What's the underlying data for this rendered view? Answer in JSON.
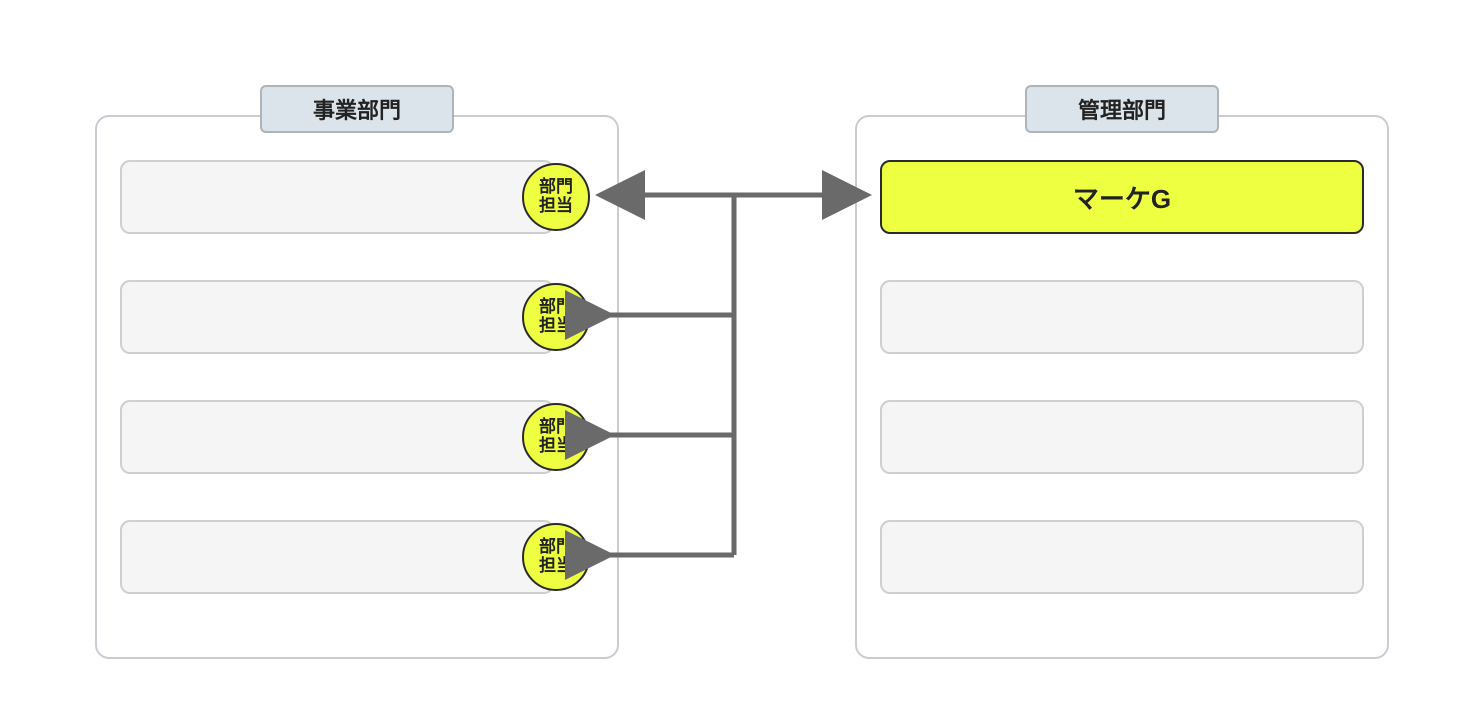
{
  "left_group": {
    "label": "事業部門",
    "staff_label_line1": "部門",
    "staff_label_line2": "担当",
    "rows": 4
  },
  "right_group": {
    "label": "管理部門",
    "highlight_unit": "マーケG",
    "rows": 4
  },
  "colors": {
    "highlight": "#eeff41",
    "group_label_bg": "#dbe4ea",
    "box_border": "#c9cdd2",
    "slot_bg": "#f5f5f5",
    "connector": "#6a6a6a"
  }
}
